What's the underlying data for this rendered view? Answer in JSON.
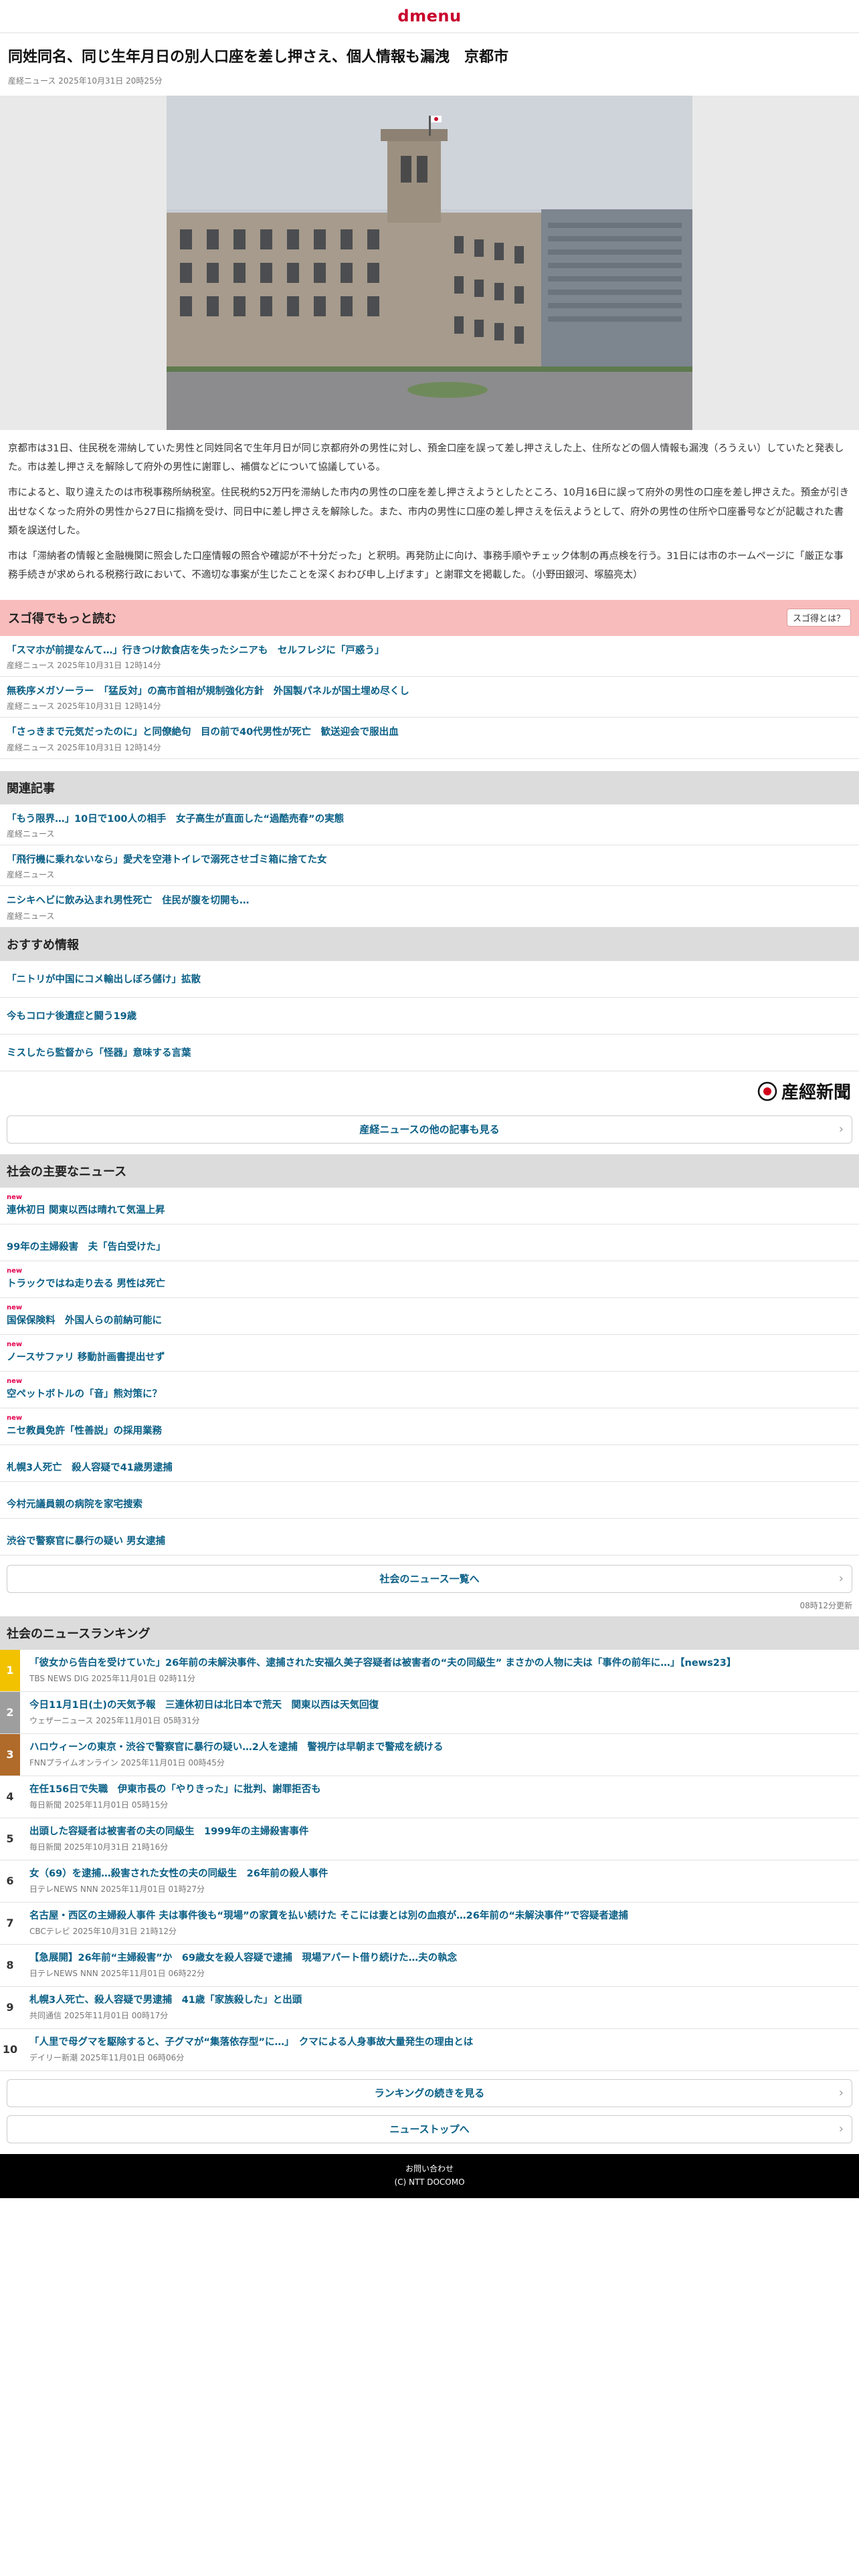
{
  "header": {
    "logo": "dmenu"
  },
  "article": {
    "title": "同姓同名、同じ生年月日の別人口座を差し押さえ、個人情報も漏洩　京都市",
    "meta": "産経ニュース 2025年10月31日 20時25分",
    "paragraphs": [
      "京都市は31日、住民税を滞納していた男性と同姓同名で生年月日が同じ京都府外の男性に対し、預金口座を誤って差し押さえした上、住所などの個人情報も漏洩（ろうえい）していたと発表した。市は差し押さえを解除して府外の男性に謝罪し、補償などについて協議している。",
      "市によると、取り違えたのは市税事務所納税室。住民税約52万円を滞納した市内の男性の口座を差し押さえようとしたところ、10月16日に誤って府外の男性の口座を差し押さえた。預金が引き出せなくなった府外の男性から27日に指摘を受け、同日中に差し押さえを解除した。また、市内の男性に口座の差し押さえを伝えようとして、府外の男性の住所や口座番号などが記載された書類を誤送付した。",
      "市は「滞納者の情報と金融機関に照会した口座情報の照合や確認が不十分だった」と釈明。再発防止に向け、事務手順やチェック体制の再点検を行う。31日には市のホームページに「厳正な事務手続きが求められる税務行政において、不適切な事案が生じたことを深くおわび申し上げます」と謝罪文を掲載した。（小野田銀河、塚脇亮太）"
    ]
  },
  "sugotoku": {
    "title": "スゴ得でもっと読む",
    "button": "スゴ得とは？",
    "items": [
      {
        "title": "「スマホが前提なんて…」行きつけ飲食店を失ったシニアも　セルフレジに「戸惑う」",
        "meta": "産経ニュース 2025年10月31日 12時14分"
      },
      {
        "title": "無秩序メガソーラー　「猛反対」の高市首相が規制強化方針　外国製パネルが国土埋め尽くし",
        "meta": "産経ニュース 2025年10月31日 12時14分"
      },
      {
        "title": "「さっきまで元気だったのに」と同僚絶句　目の前で40代男性が死亡　歓送迎会で服出血",
        "meta": "産経ニュース 2025年10月31日 12時14分"
      }
    ]
  },
  "related": {
    "title": "関連記事",
    "items": [
      {
        "title": "「もう限界…」10日で100人の相手　女子高生が直面した“過酷売春”の実態",
        "meta": "産経ニュース"
      },
      {
        "title": "「飛行機に乗れないなら」愛犬を空港トイレで溺死させゴミ箱に捨てた女",
        "meta": "産経ニュース"
      },
      {
        "title": "ニシキヘビに飲み込まれ男性死亡　住民が腹を切開も…",
        "meta": "産経ニュース"
      }
    ]
  },
  "recommended": {
    "title": "おすすめ情報",
    "items": [
      "「ニトリが中国にコメ輸出しぼろ儲け」拡散",
      "今もコロナ後遺症と闘う19歳",
      "ミスしたら監督から「怪器」意味する言葉"
    ]
  },
  "brand": {
    "name": "産經新聞"
  },
  "more_sankei": "産経ニュースの他の記事も見る",
  "social_news": {
    "title": "社会の主要なニュース",
    "new_label": "new",
    "items": [
      {
        "title": "連休初日 関東以西は晴れて気温上昇",
        "is_new": true
      },
      {
        "title": "99年の主婦殺害　夫「告白受けた」",
        "is_new": false
      },
      {
        "title": "トラックではね走り去る 男性は死亡",
        "is_new": true
      },
      {
        "title": "国保保険料　外国人らの前納可能に",
        "is_new": true
      },
      {
        "title": "ノースサファリ 移動計画書提出せず",
        "is_new": true
      },
      {
        "title": "空ペットボトルの「音」熊対策に？",
        "is_new": true
      },
      {
        "title": "ニセ教員免許「性善説」の採用業務",
        "is_new": true
      },
      {
        "title": "札幌3人死亡　殺人容疑で41歳男逮捕",
        "is_new": false
      },
      {
        "title": "今村元議員親の病院を家宅捜索",
        "is_new": false
      },
      {
        "title": "渋谷で警察官に暴行の疑い 男女逮捕",
        "is_new": false
      }
    ],
    "more": "社会のニュース一覧へ",
    "updated": "08時12分更新"
  },
  "ranking": {
    "title": "社会のニュースランキング",
    "items": [
      {
        "rank": "1",
        "title": "「彼女から告白を受けていた」26年前の未解決事件、逮捕された安福久美子容疑者は被害者の“夫の同級生” まさかの人物に夫は「事件の前年に…」【news23】",
        "meta": "TBS NEWS DIG 2025年11月01日 02時11分"
      },
      {
        "rank": "2",
        "title": "今日11月1日(土)の天気予報　三連休初日は北日本で荒天　関東以西は天気回復",
        "meta": "ウェザーニュース 2025年11月01日 05時31分"
      },
      {
        "rank": "3",
        "title": "ハロウィーンの東京・渋谷で警察官に暴行の疑い…2人を逮捕　警視庁は早朝まで警戒を続ける",
        "meta": "FNNプライムオンライン 2025年11月01日 00時45分"
      },
      {
        "rank": "4",
        "title": "在任156日で失職　伊東市長の「やりきった」に批判、謝罪拒否も",
        "meta": "毎日新聞 2025年11月01日 05時15分"
      },
      {
        "rank": "5",
        "title": "出頭した容疑者は被害者の夫の同級生　1999年の主婦殺害事件",
        "meta": "毎日新聞 2025年10月31日 21時16分"
      },
      {
        "rank": "6",
        "title": "女（69）を逮捕…殺害された女性の夫の同級生　26年前の殺人事件",
        "meta": "日テレNEWS NNN 2025年11月01日 01時27分"
      },
      {
        "rank": "7",
        "title": "名古屋・西区の主婦殺人事件 夫は事件後も“現場”の家賃を払い続けた そこには妻とは別の血痕が…26年前の“未解決事件”で容疑者逮捕",
        "meta": "CBCテレビ 2025年10月31日 21時12分"
      },
      {
        "rank": "8",
        "title": "【急展開】26年前“主婦殺害”か　69歳女を殺人容疑で逮捕　現場アパート借り続けた…夫の執念",
        "meta": "日テレNEWS NNN 2025年11月01日 06時22分"
      },
      {
        "rank": "9",
        "title": "札幌3人死亡、殺人容疑で男逮捕　41歳「家族殺した」と出頭",
        "meta": "共同通信 2025年11月01日 00時17分"
      },
      {
        "rank": "10",
        "title": "「人里で母グマを駆除すると、子グマが“集落依存型”に…」　クマによる人身事故大量発生の理由とは",
        "meta": "デイリー新潮 2025年11月01日 06時06分"
      }
    ],
    "more": "ランキングの続きを見る",
    "top": "ニューストップへ"
  },
  "footer": {
    "contact": "お問い合わせ",
    "copyright": "(C) NTT DOCOMO"
  }
}
